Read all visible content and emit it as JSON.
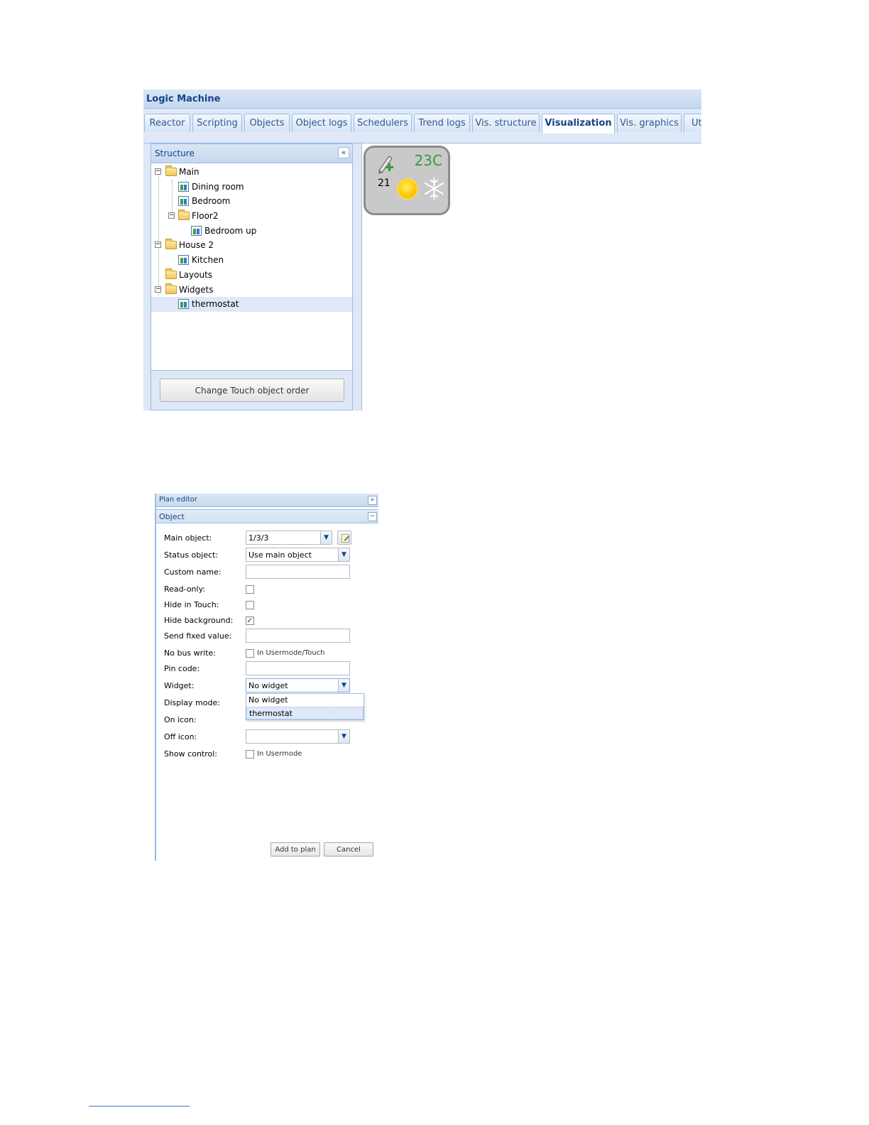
{
  "app": {
    "title": "Logic Machine"
  },
  "tabs": [
    {
      "label": "Reactor"
    },
    {
      "label": "Scripting"
    },
    {
      "label": "Objects"
    },
    {
      "label": "Object logs"
    },
    {
      "label": "Schedulers"
    },
    {
      "label": "Trend logs"
    },
    {
      "label": "Vis. structure"
    },
    {
      "label": "Visualization",
      "active": true
    },
    {
      "label": "Vis. graphics"
    },
    {
      "label": "Uti"
    }
  ],
  "structure": {
    "title": "Structure",
    "collapse_icon": "«",
    "tree": [
      {
        "label": "Main",
        "type": "folder",
        "expanded": true
      },
      {
        "label": "Dining room",
        "type": "page"
      },
      {
        "label": "Bedroom",
        "type": "page"
      },
      {
        "label": "Floor2",
        "type": "folder",
        "expanded": true
      },
      {
        "label": "Bedroom up",
        "type": "page"
      },
      {
        "label": "House 2",
        "type": "folder",
        "expanded": true
      },
      {
        "label": "Kitchen",
        "type": "page"
      },
      {
        "label": "Layouts",
        "type": "folder"
      },
      {
        "label": "Widgets",
        "type": "folder",
        "expanded": true
      },
      {
        "label": "thermostat",
        "type": "page",
        "selected": true
      }
    ],
    "change_order_button": "Change Touch object order"
  },
  "widget": {
    "temperature": "23C",
    "setpoint": "21",
    "icons": [
      "edit-plus-icon",
      "sun-icon",
      "snowflake-icon"
    ]
  },
  "plan_editor": {
    "title": "Plan editor",
    "expand_icon": "»",
    "section_title": "Object",
    "section_toggle": "−",
    "fields": {
      "main_object": {
        "label": "Main object:",
        "value": "1/3/3"
      },
      "status_object": {
        "label": "Status object:",
        "value": "Use main object"
      },
      "custom_name": {
        "label": "Custom name:",
        "value": ""
      },
      "read_only": {
        "label": "Read-only:",
        "checked": false
      },
      "hide_touch": {
        "label": "Hide in Touch:",
        "checked": false
      },
      "hide_background": {
        "label": "Hide background:",
        "checked": true
      },
      "send_fixed": {
        "label": "Send fixed value:",
        "value": ""
      },
      "no_bus_write": {
        "label": "No bus write:",
        "check_label": "In Usermode/Touch",
        "checked": false
      },
      "pin_code": {
        "label": "Pin code:",
        "value": ""
      },
      "widget": {
        "label": "Widget:",
        "value": "No widget"
      },
      "display_mode": {
        "label": "Display mode:"
      },
      "on_icon": {
        "label": "On icon:"
      },
      "off_icon": {
        "label": "Off icon:",
        "value": ""
      },
      "show_control": {
        "label": "Show control:",
        "check_label": "In Usermode",
        "checked": false
      }
    },
    "widget_options": [
      "No widget",
      "thermostat"
    ],
    "buttons": {
      "add": "Add to plan",
      "cancel": "Cancel"
    }
  }
}
